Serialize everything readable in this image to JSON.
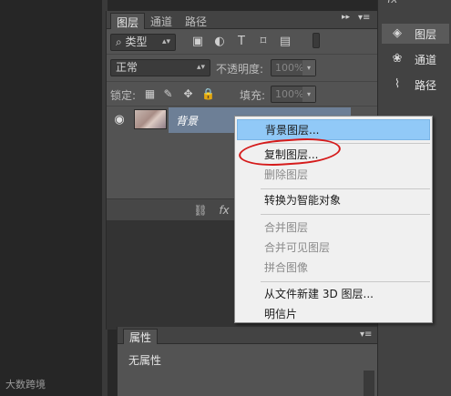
{
  "layers_panel": {
    "tabs": [
      "图层",
      "通道",
      "路径"
    ],
    "active_tab": "图层",
    "kind_filter": "类型",
    "blend_mode": "正常",
    "opacity_label": "不透明度:",
    "opacity_value": "100%",
    "lock_label": "锁定:",
    "fill_label": "填充:",
    "fill_value": "100%",
    "layer": {
      "name": "背景",
      "visible": true
    },
    "bottom_icons": [
      "link-icon",
      "fx-icon"
    ],
    "fx_text": "fx"
  },
  "properties_panel": {
    "tab": "属性",
    "content": "无属性"
  },
  "dock": {
    "top_label": "fx",
    "items": [
      {
        "label": "图层",
        "icon": "layers-icon",
        "active": true
      },
      {
        "label": "通道",
        "icon": "channels-icon",
        "active": false
      },
      {
        "label": "路径",
        "icon": "paths-icon",
        "active": false
      }
    ]
  },
  "context_menu": {
    "items": [
      {
        "label": "背景图层...",
        "state": "highlighted"
      },
      {
        "label": "复制图层...",
        "state": "enabled"
      },
      {
        "label": "删除图层",
        "state": "disabled"
      },
      {
        "label": "转换为智能对象",
        "state": "enabled"
      },
      {
        "label": "合并图层",
        "state": "disabled"
      },
      {
        "label": "合并可见图层",
        "state": "disabled"
      },
      {
        "label": "拼合图像",
        "state": "disabled"
      },
      {
        "label": "从文件新建 3D 图层...",
        "state": "enabled"
      },
      {
        "label": "明信片",
        "state": "enabled"
      }
    ]
  },
  "annotation_color": "#d51b1b",
  "highlight_color": "#91c9f7",
  "watermark": "大数跨境"
}
